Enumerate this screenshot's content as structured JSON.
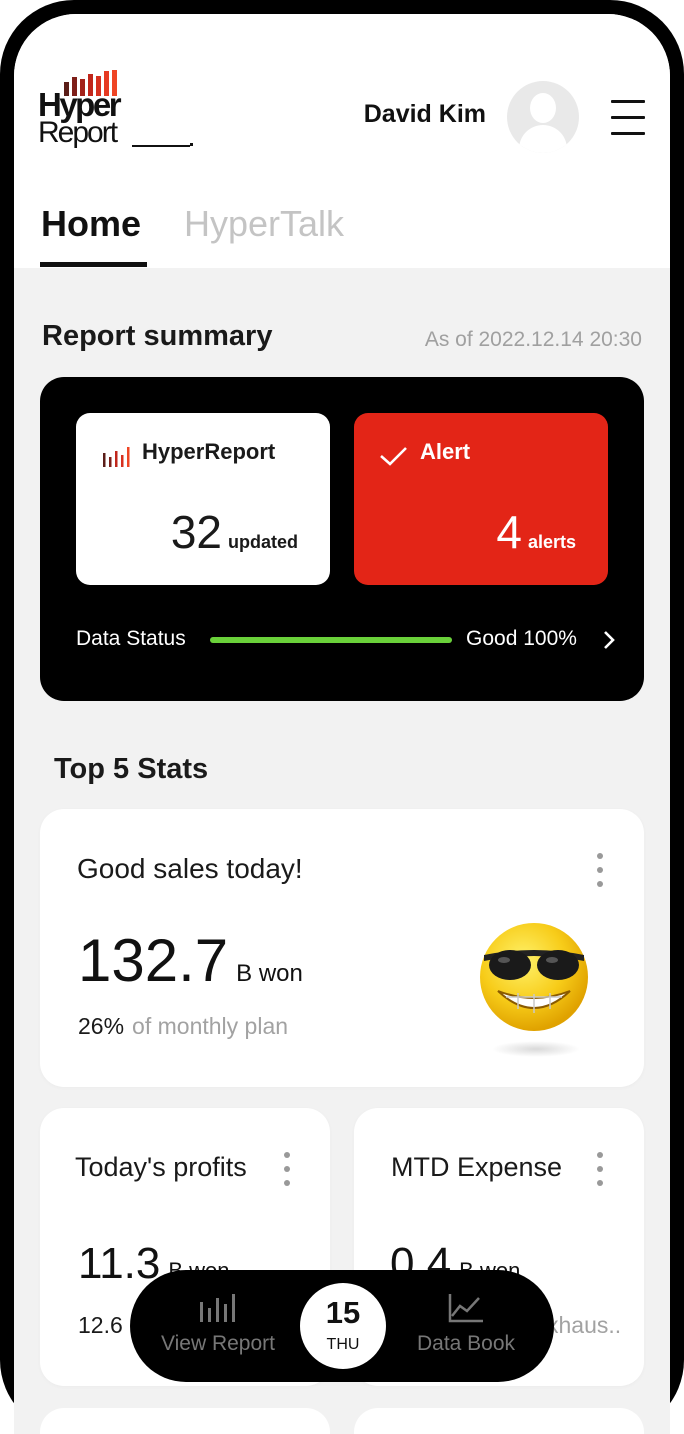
{
  "header": {
    "logo": {
      "line1": "Hyper",
      "line2": "Report"
    },
    "user_name": "David Kim"
  },
  "tabs": [
    {
      "label": "Home",
      "active": true
    },
    {
      "label": "HyperTalk",
      "active": false
    }
  ],
  "report_summary": {
    "title": "Report summary",
    "as_of": "As of 2022.12.14 20:30",
    "hyperreport": {
      "label": "HyperReport",
      "value": "32",
      "unit": "updated"
    },
    "alert": {
      "label": "Alert",
      "value": "4",
      "unit": "alerts"
    },
    "data_status": {
      "label": "Data Status",
      "value": "Good 100%",
      "progress_fraction": 1.0
    }
  },
  "top_stats": {
    "title": "Top 5 Stats",
    "main": {
      "title": "Good sales today!",
      "value": "132.7",
      "unit": "B won",
      "percent": "26%",
      "percent_label": "of monthly plan",
      "emoji": "sunglasses-grin-emoji"
    },
    "profits": {
      "title": "Today's profits",
      "value": "11.3",
      "unit": "B won",
      "sub": "12.6"
    },
    "expense": {
      "title": "MTD Expense",
      "value": "0.4",
      "unit": "B won",
      "sub": "xhaus.."
    }
  },
  "bottom_nav": {
    "view_report": {
      "label": "View Report",
      "icon": "bar-chart-icon"
    },
    "date": {
      "day": "15",
      "weekday": "THU"
    },
    "data_book": {
      "label": "Data Book",
      "icon": "line-chart-icon"
    }
  },
  "colors": {
    "alert_red": "#e32517",
    "status_green": "#6ad13a",
    "logo_red": "#c0261b"
  }
}
